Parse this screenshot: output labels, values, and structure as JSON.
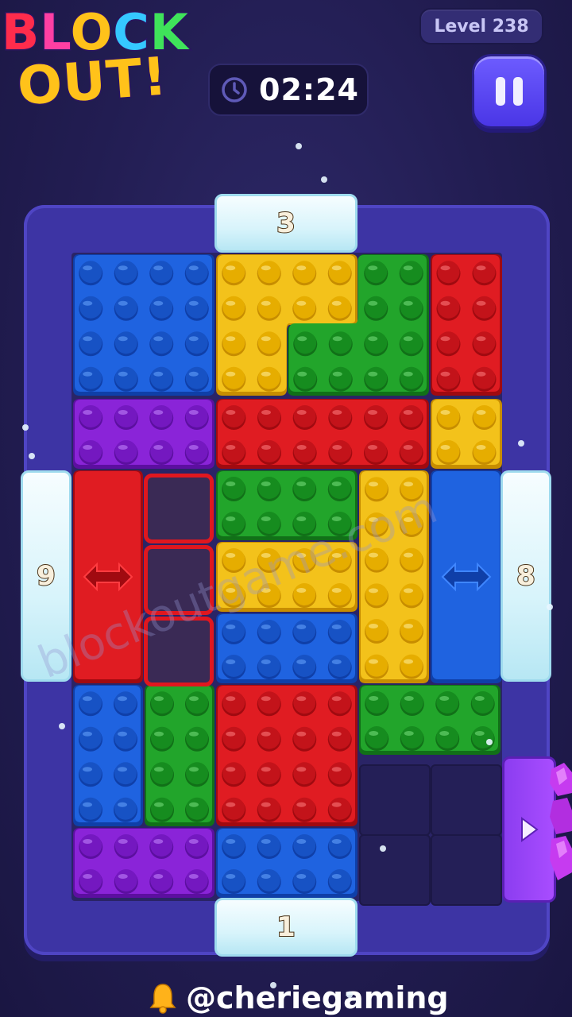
{
  "logo": {
    "line1": [
      "B",
      "L",
      "O",
      "C",
      "K"
    ],
    "line2": "OUT!"
  },
  "level_label": "Level 238",
  "timer": {
    "value": "02:24",
    "icon": "clock-icon"
  },
  "pause": {
    "icon": "pause-icon"
  },
  "gates": {
    "top": "3",
    "left": "9",
    "right": "8",
    "bottom": "1"
  },
  "exit_gate_icon": "play-arrow-icon",
  "watermark": "blockoutgame.com",
  "footer": {
    "handle": "@cheriegaming",
    "icon": "bell-icon"
  },
  "colors": {
    "blue": "#1f63e0",
    "yellow": "#f3c21b",
    "green": "#22a52b",
    "red": "#e01c22",
    "purple": "#8a24d8"
  },
  "blocks": [
    {
      "id": "blue-top-left",
      "color": "blue"
    },
    {
      "id": "yellow-l",
      "color": "yellow"
    },
    {
      "id": "green-l",
      "color": "green"
    },
    {
      "id": "red-top-right",
      "color": "red"
    },
    {
      "id": "purple-row2",
      "color": "purple"
    },
    {
      "id": "red-row2",
      "color": "red"
    },
    {
      "id": "yellow-row2",
      "color": "yellow"
    },
    {
      "id": "red-arrow-tall",
      "color": "red",
      "icon": "horizontal-arrows-icon"
    },
    {
      "id": "green-mid",
      "color": "green"
    },
    {
      "id": "yellow-mid",
      "color": "yellow"
    },
    {
      "id": "blue-mid",
      "color": "blue"
    },
    {
      "id": "yellow-tall",
      "color": "yellow"
    },
    {
      "id": "blue-arrow-tall",
      "color": "blue",
      "icon": "horizontal-arrows-icon"
    },
    {
      "id": "blue-lower-left",
      "color": "blue"
    },
    {
      "id": "green-lower",
      "color": "green"
    },
    {
      "id": "red-lower",
      "color": "red"
    },
    {
      "id": "green-lower-right",
      "color": "green"
    },
    {
      "id": "purple-bottom",
      "color": "purple"
    },
    {
      "id": "blue-bottom",
      "color": "blue"
    }
  ]
}
